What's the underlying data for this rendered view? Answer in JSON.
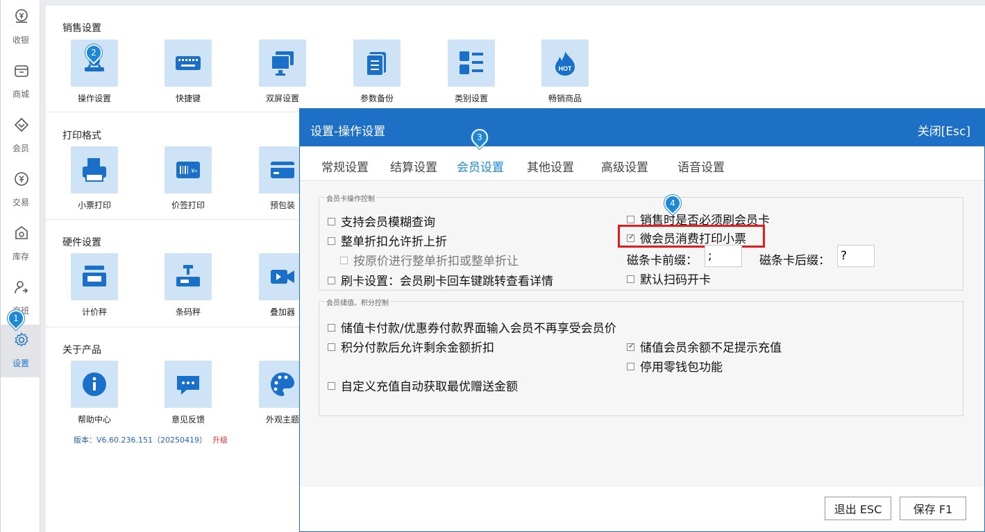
{
  "sidebar": {
    "items": [
      {
        "label": "收银",
        "icon": "cashier-icon"
      },
      {
        "label": "商城",
        "icon": "mall-icon"
      },
      {
        "label": "会员",
        "icon": "member-icon"
      },
      {
        "label": "交易",
        "icon": "transaction-icon"
      },
      {
        "label": "库存",
        "icon": "inventory-icon"
      },
      {
        "label": "交班",
        "icon": "shift-icon"
      },
      {
        "label": "设置",
        "icon": "gear-icon"
      }
    ]
  },
  "sections": [
    {
      "title": "销售设置",
      "tiles": [
        "操作设置",
        "快捷键",
        "双屏设置",
        "参数备份",
        "类别设置",
        "畅销商品"
      ]
    },
    {
      "title": "打印格式",
      "tiles": [
        "小票打印",
        "价签打印",
        "预包装"
      ]
    },
    {
      "title": "硬件设置",
      "tiles": [
        "计价秤",
        "条码秤",
        "叠加器"
      ]
    },
    {
      "title": "关于产品",
      "tiles": [
        "帮助中心",
        "意见反馈",
        "外观主题"
      ]
    }
  ],
  "hot_icon_text": "HOT",
  "version": {
    "text": "版本：V6.60.236.151（20250419）",
    "upgrade": "升级"
  },
  "badges": [
    "1",
    "2",
    "3",
    "4"
  ],
  "dialog": {
    "title": "设置-操作设置",
    "close": "关闭[Esc]",
    "tabs": [
      "常规设置",
      "结算设置",
      "会员设置",
      "其他设置",
      "高级设置",
      "语音设置"
    ],
    "active_tab": "会员设置",
    "group1": {
      "legend": "会员卡操作控制",
      "left": [
        {
          "label": "支持会员模糊查询",
          "checked": false
        },
        {
          "label": "整单折扣允许折上折",
          "checked": false
        },
        {
          "label": "按原价进行整单折扣或整单折让",
          "checked": false
        },
        {
          "label": "刷卡设置：会员刷卡回车键跳转查看详情",
          "checked": false
        }
      ],
      "right": [
        {
          "label": "销售时是否必须刷会员卡",
          "checked": false
        },
        {
          "label": "微会员消费打印小票",
          "checked": true
        },
        {
          "label": "默认扫码开卡",
          "checked": false
        }
      ],
      "prefix_label": "磁条卡前缀：",
      "prefix_value": ";",
      "suffix_label": "磁条卡后缀：",
      "suffix_value": "?"
    },
    "group2": {
      "legend": "会员储值、积分控制",
      "left": [
        {
          "label": "储值卡付款/优惠券付款界面输入会员不再享受会员价",
          "checked": false
        },
        {
          "label": "积分付款后允许剩余金额折扣",
          "checked": false
        },
        {
          "label": "自定义充值自动获取最优赠送金额",
          "checked": false
        }
      ],
      "right": [
        {
          "label": "储值会员余额不足提示充值",
          "checked": true
        },
        {
          "label": "停用零钱包功能",
          "checked": false
        }
      ]
    },
    "buttons": {
      "exit": "退出 ESC",
      "save": "保存 F1"
    }
  },
  "colors": {
    "accent": "#1e6fc6",
    "tile_bg": "#cfe3f7",
    "icon": "#1a6fc9",
    "highlight": "#e31c1c"
  }
}
